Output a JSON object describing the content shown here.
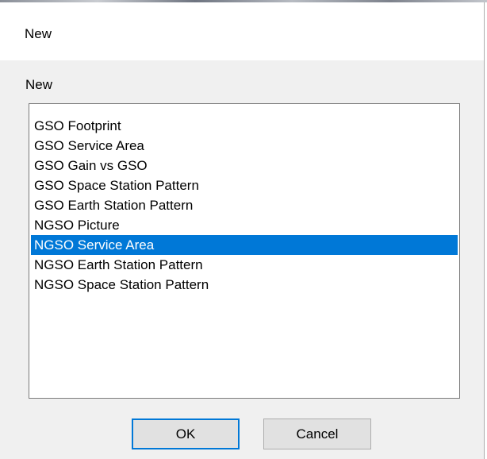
{
  "dialog": {
    "title": "New",
    "group_label": "New",
    "list": {
      "items": [
        "GSO Footprint",
        "GSO Service Area",
        "GSO Gain vs GSO",
        "GSO Space Station Pattern",
        "GSO Earth Station Pattern",
        "NGSO Picture",
        "NGSO Service Area",
        "NGSO Earth Station Pattern",
        "NGSO Space Station Pattern"
      ],
      "selected_index": 6
    },
    "buttons": {
      "ok_label": "OK",
      "cancel_label": "Cancel"
    }
  },
  "colors": {
    "selection": "#0078d7",
    "dialog_bg": "#f0f0f0",
    "titlebar_bg": "#ffffff"
  }
}
